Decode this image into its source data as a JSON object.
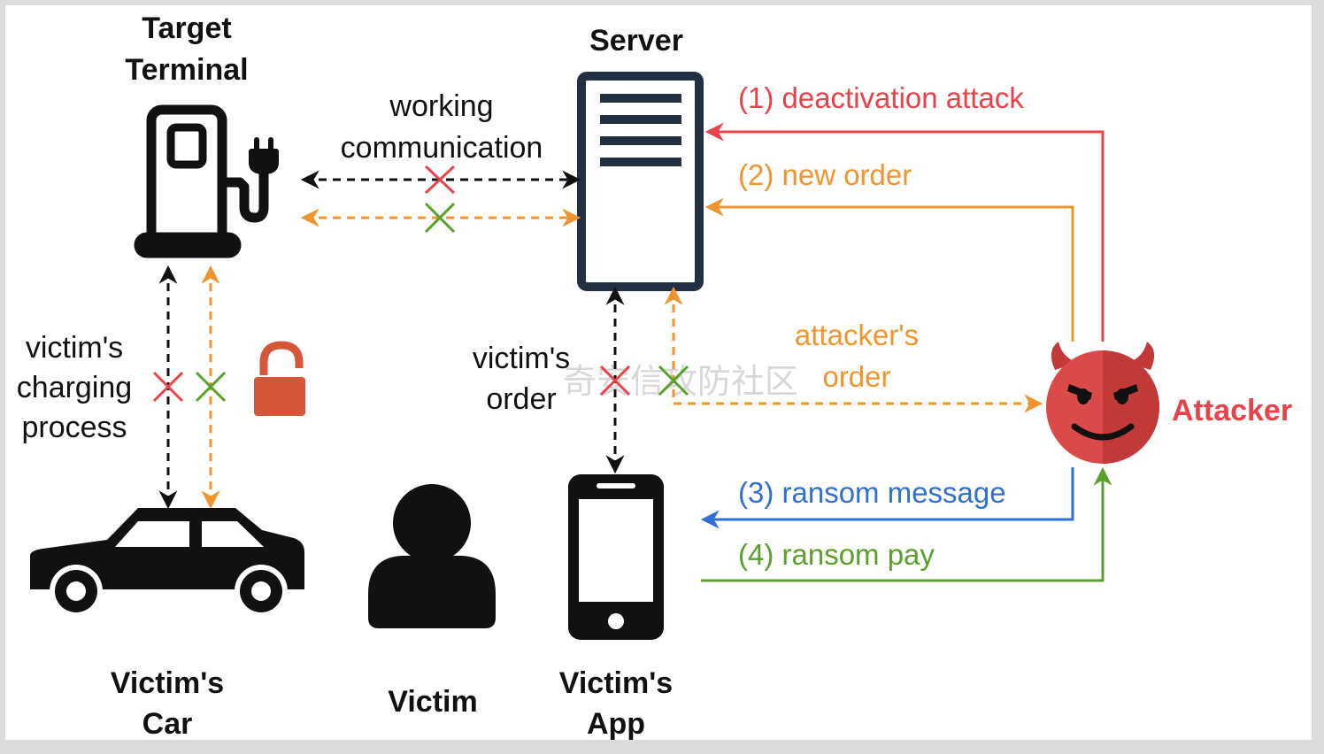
{
  "nodes": {
    "terminal": {
      "label_line1": "Target",
      "label_line2": "Terminal"
    },
    "server": {
      "label": "Server"
    },
    "attacker": {
      "label": "Attacker"
    },
    "car": {
      "label_line1": "Victim's",
      "label_line2": "Car"
    },
    "victim": {
      "label": "Victim"
    },
    "app": {
      "label_line1": "Victim's",
      "label_line2": "App"
    }
  },
  "edges": {
    "working_comm": {
      "line1": "working",
      "line2": "communication"
    },
    "charging": {
      "line1": "victim's",
      "line2": "charging",
      "line3": "process"
    },
    "victim_order": {
      "line1": "victim's",
      "line2": "order"
    },
    "attacker_order": {
      "line1": "attacker's",
      "line2": "order"
    },
    "deactivation": {
      "label": "(1) deactivation attack"
    },
    "new_order": {
      "label": "(2) new order"
    },
    "ransom_message": {
      "label": "(3) ransom message"
    },
    "ransom_pay": {
      "label": "(4) ransom pay"
    }
  },
  "watermark": "奇安信攻防社区",
  "colors": {
    "black": "#111111",
    "red": "#e8424a",
    "orange": "#f0952e",
    "blue": "#2f6fd6",
    "green": "#5aa02c",
    "lock": "#d6563a",
    "devil": "#d94a48",
    "devil_dark": "#c23a38"
  }
}
